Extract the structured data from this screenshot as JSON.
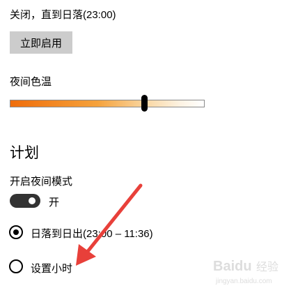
{
  "night_light": {
    "status_text": "关闭，直到日落(23:00)",
    "enable_button": "立即启用",
    "color_temp_label": "夜间色温",
    "color_temp_level": 0.69
  },
  "schedule": {
    "title": "计划",
    "toggle_label": "开启夜间模式",
    "toggle_state": "开",
    "toggle_on": true,
    "options": [
      {
        "label": "日落到日出(23:00 – 11:36)",
        "selected": true
      },
      {
        "label": "设置小时",
        "selected": false
      }
    ]
  },
  "annotation": {
    "arrow_color": "#e8403a"
  },
  "watermark": {
    "text": "Baidu 经验",
    "subtext": "jingyan.baidu.com"
  }
}
